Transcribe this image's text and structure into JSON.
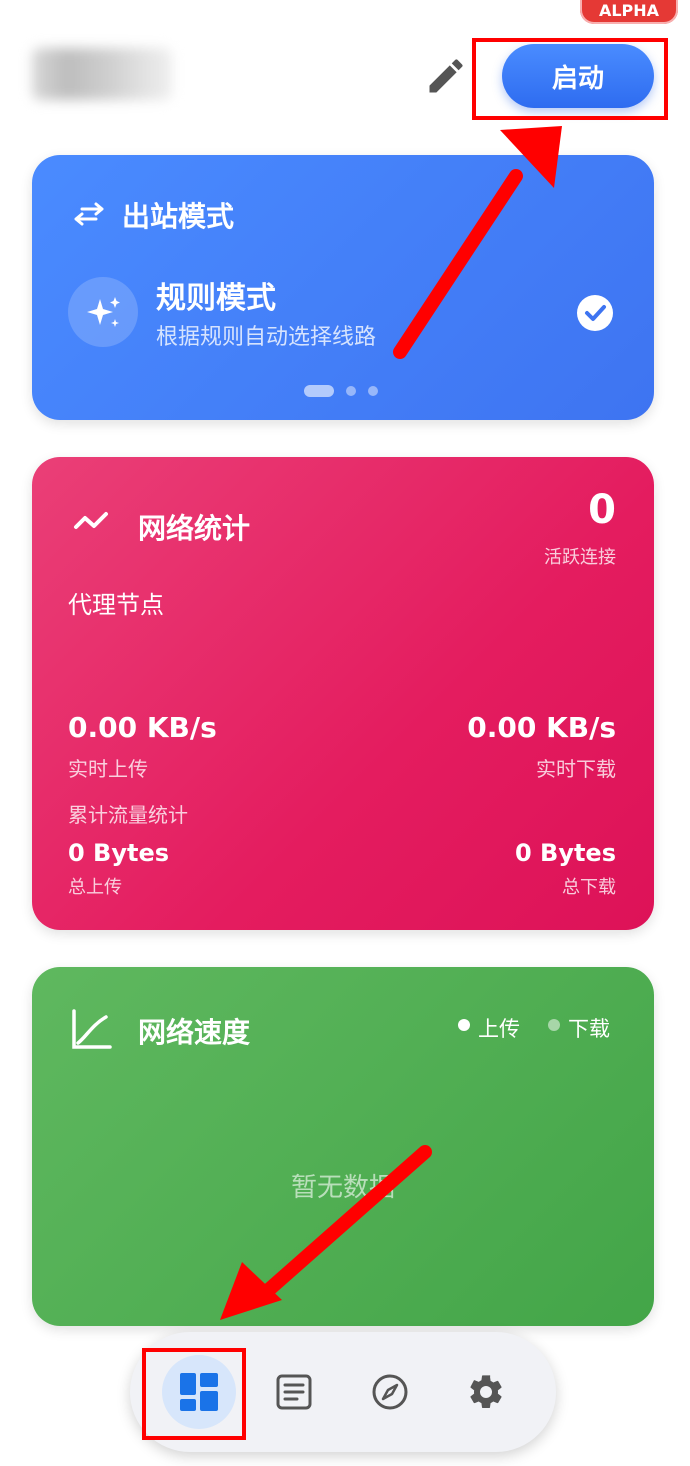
{
  "header": {
    "badge": "ALPHA",
    "start_button": "启动"
  },
  "outbound_card": {
    "title": "出站模式",
    "mode_title": "规则模式",
    "mode_desc": "根据规则自动选择线路",
    "pages": 3,
    "active_page": 1
  },
  "network_stats": {
    "title": "网络统计",
    "active_connections": "0",
    "active_connections_label": "活跃连接",
    "proxy_node_label": "代理节点",
    "upload_speed": "0.00 KB/s",
    "upload_speed_label": "实时上传",
    "download_speed": "0.00 KB/s",
    "download_speed_label": "实时下载",
    "traffic_label": "累计流量统计",
    "total_upload": "0 Bytes",
    "total_upload_label": "总上传",
    "total_download": "0 Bytes",
    "total_download_label": "总下载"
  },
  "network_speed": {
    "title": "网络速度",
    "legend_upload": "上传",
    "legend_download": "下载",
    "empty_text": "暂无数据"
  },
  "bottom_nav": {
    "items": [
      {
        "icon": "dashboard-icon",
        "active": true
      },
      {
        "icon": "list-icon",
        "active": false
      },
      {
        "icon": "compass-icon",
        "active": false
      },
      {
        "icon": "gear-icon",
        "active": false
      }
    ]
  },
  "colors": {
    "blue_card": "#4080fa",
    "pink_card": "#e62a67",
    "green_card": "#4caf50",
    "accent": "#2e6cf0",
    "highlight": "#ff0000"
  }
}
